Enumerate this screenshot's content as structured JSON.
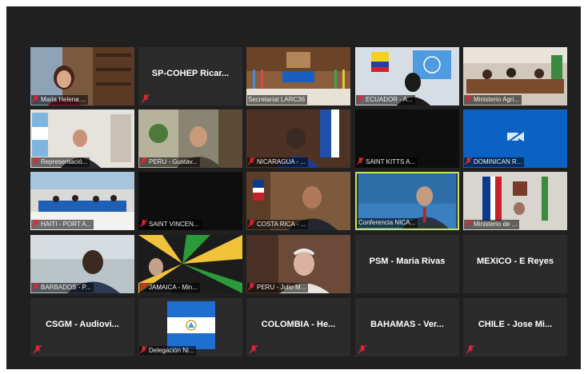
{
  "tiles": [
    {
      "label": "Maria Helena ..."
    },
    {
      "name": "SP-COHEP  Ricar..."
    },
    {
      "label": "Secretariat LARC36"
    },
    {
      "label": "ECUADOR - A..."
    },
    {
      "label": "Ministerio Agri..."
    },
    {
      "label": "Representació..."
    },
    {
      "label": "PERU - Gustav..."
    },
    {
      "label": "NICARAGUA - ..."
    },
    {
      "label": "SAINT KITTS A..."
    },
    {
      "label": "DOMINICAN R..."
    },
    {
      "label": "HAITI - PORT A..."
    },
    {
      "label": "SAINT VINCEN..."
    },
    {
      "label": "COSTA RICA - ..."
    },
    {
      "label": "Conferencia NICA..."
    },
    {
      "label": "Ministerio de ..."
    },
    {
      "label": "BARBADOS - P..."
    },
    {
      "label": "JAMAICA - Min..."
    },
    {
      "label": "PERU - Julio M..."
    },
    {
      "name": "PSM - Maria Rivas"
    },
    {
      "name": "MEXICO - E Reyes"
    },
    {
      "name": "CSGM  - Audiovi..."
    },
    {
      "label": "Delegación Ni..."
    },
    {
      "name": "COLOMBIA  - He..."
    },
    {
      "name": "BAHAMAS - Ver..."
    },
    {
      "name": "CHILE - Jose Mi..."
    }
  ],
  "colors": {
    "muted_mic": "#e0263a",
    "active_border": "#c9e45a",
    "background": "#202020"
  }
}
